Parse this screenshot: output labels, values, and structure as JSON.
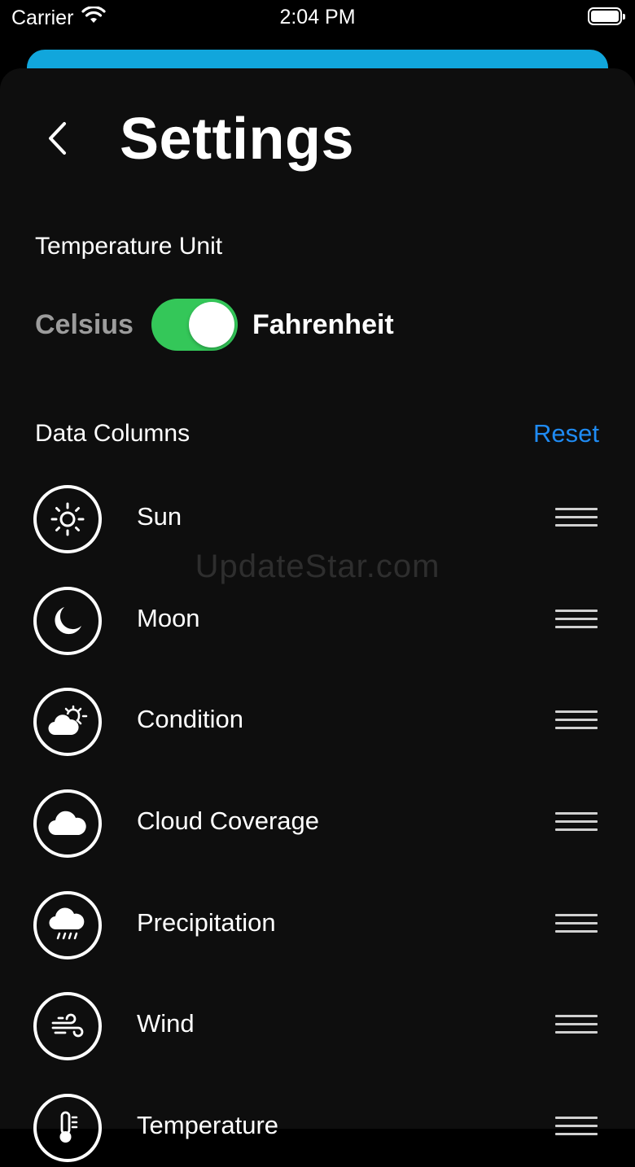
{
  "status_bar": {
    "carrier": "Carrier",
    "time": "2:04 PM"
  },
  "header": {
    "title": "Settings"
  },
  "temperature_unit": {
    "label": "Temperature Unit",
    "option_left": "Celsius",
    "option_right": "Fahrenheit",
    "toggle_on": true,
    "toggle_color": "#34c759"
  },
  "data_columns": {
    "label": "Data Columns",
    "reset_label": "Reset",
    "reset_color": "#1f8bf3",
    "items": [
      {
        "label": "Sun",
        "icon": "sun-icon"
      },
      {
        "label": "Moon",
        "icon": "moon-icon"
      },
      {
        "label": "Condition",
        "icon": "partly-cloudy-icon"
      },
      {
        "label": "Cloud Coverage",
        "icon": "cloud-icon"
      },
      {
        "label": "Precipitation",
        "icon": "rain-cloud-icon"
      },
      {
        "label": "Wind",
        "icon": "wind-icon"
      },
      {
        "label": "Temperature",
        "icon": "thermometer-icon"
      }
    ]
  },
  "watermark": "UpdateStar.com",
  "colors": {
    "background": "#000000",
    "sheet": "#0e0e0e",
    "peek_sheet": "#11a6dc"
  }
}
